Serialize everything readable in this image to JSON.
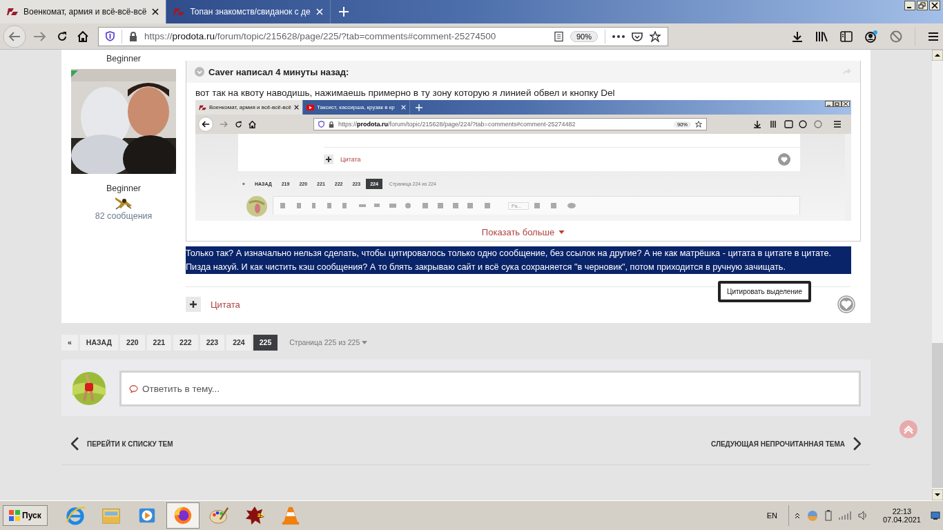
{
  "browser": {
    "tabs": [
      {
        "title": "Военкомат, армия и всё-всё-всё",
        "selected": true
      },
      {
        "title": "Топан знакомств/свиданок с де",
        "selected": false
      }
    ],
    "url": {
      "scheme": "https://",
      "host": "prodota.ru",
      "path": "/forum/topic/215628/page/225/?tab=comments#comment-25274500"
    },
    "zoom": "90%"
  },
  "post": {
    "author": {
      "rank_top": "Beginner",
      "rank": "Beginner",
      "posts": "82 сообщения"
    },
    "quote": {
      "header": "Caver написал 4 минуты назад:",
      "text": "вот так на квоту наводишь, нажимаешь примерно в ту зону которую я линией обвел и кнопку Del",
      "screenshot": {
        "tabs": [
          {
            "title": "Военкомат, армия и всё-всё-всё",
            "selected": true
          },
          {
            "title": "Таксист, кассирша, крузак в кр",
            "selected": false
          }
        ],
        "url": {
          "scheme": "https://",
          "host": "prodota.ru",
          "path": "/forum/topic/215628/page/224/?tab=comments#comment-25274482"
        },
        "zoom": "90%",
        "quote_label": "Цитата",
        "first": "«",
        "back": "НАЗАД",
        "pages": [
          {
            "label": "219",
            "selected": false
          },
          {
            "label": "220",
            "selected": false
          },
          {
            "label": "221",
            "selected": false
          },
          {
            "label": "222",
            "selected": false
          },
          {
            "label": "223",
            "selected": false
          },
          {
            "label": "224",
            "selected": true
          }
        ],
        "summary": "Страница 224 из 224",
        "font_field": "Ра..."
      },
      "show_more": "Показать больше"
    },
    "body": {
      "text": "Только так? А изначально нельзя сделать, чтобы цитировалось только одно сообщение, без ссылок на другие? А не как матрёшка  - цитата в цитате в цитате. Пизда нахуй. И как чистить кэш сообщения? А то блять закрываю сайт и всё сука сохраняется \"в черновик\", потом приходится в ручную зачищать.",
      "selected": true
    },
    "tooltip": "Цитировать выделение",
    "quote_label": "Цитата"
  },
  "pagination": {
    "first": "«",
    "back": "НАЗАД",
    "pages": [
      {
        "label": "220",
        "selected": false
      },
      {
        "label": "221",
        "selected": false
      },
      {
        "label": "222",
        "selected": false
      },
      {
        "label": "223",
        "selected": false
      },
      {
        "label": "224",
        "selected": false
      },
      {
        "label": "225",
        "selected": true
      }
    ],
    "summary": "Страница 225 из 225"
  },
  "reply": {
    "placeholder": "Ответить в тему..."
  },
  "nav": {
    "prev": "ПЕРЕЙТИ К СПИСКУ ТЕМ",
    "next": "СЛЕДУЮЩАЯ НЕПРОЧИТАННАЯ ТЕМА"
  },
  "taskbar": {
    "start": "Пуск",
    "apps": [
      {
        "kind": "ie",
        "selected": false
      },
      {
        "kind": "explorer",
        "selected": false
      },
      {
        "kind": "media",
        "selected": false
      },
      {
        "kind": "firefox",
        "selected": true
      },
      {
        "kind": "paint",
        "selected": false
      },
      {
        "kind": "game",
        "label": "32",
        "selected": false
      },
      {
        "kind": "vlc",
        "selected": false
      }
    ],
    "lang": "EN",
    "time": "22:13",
    "date": "07.04.2021"
  }
}
